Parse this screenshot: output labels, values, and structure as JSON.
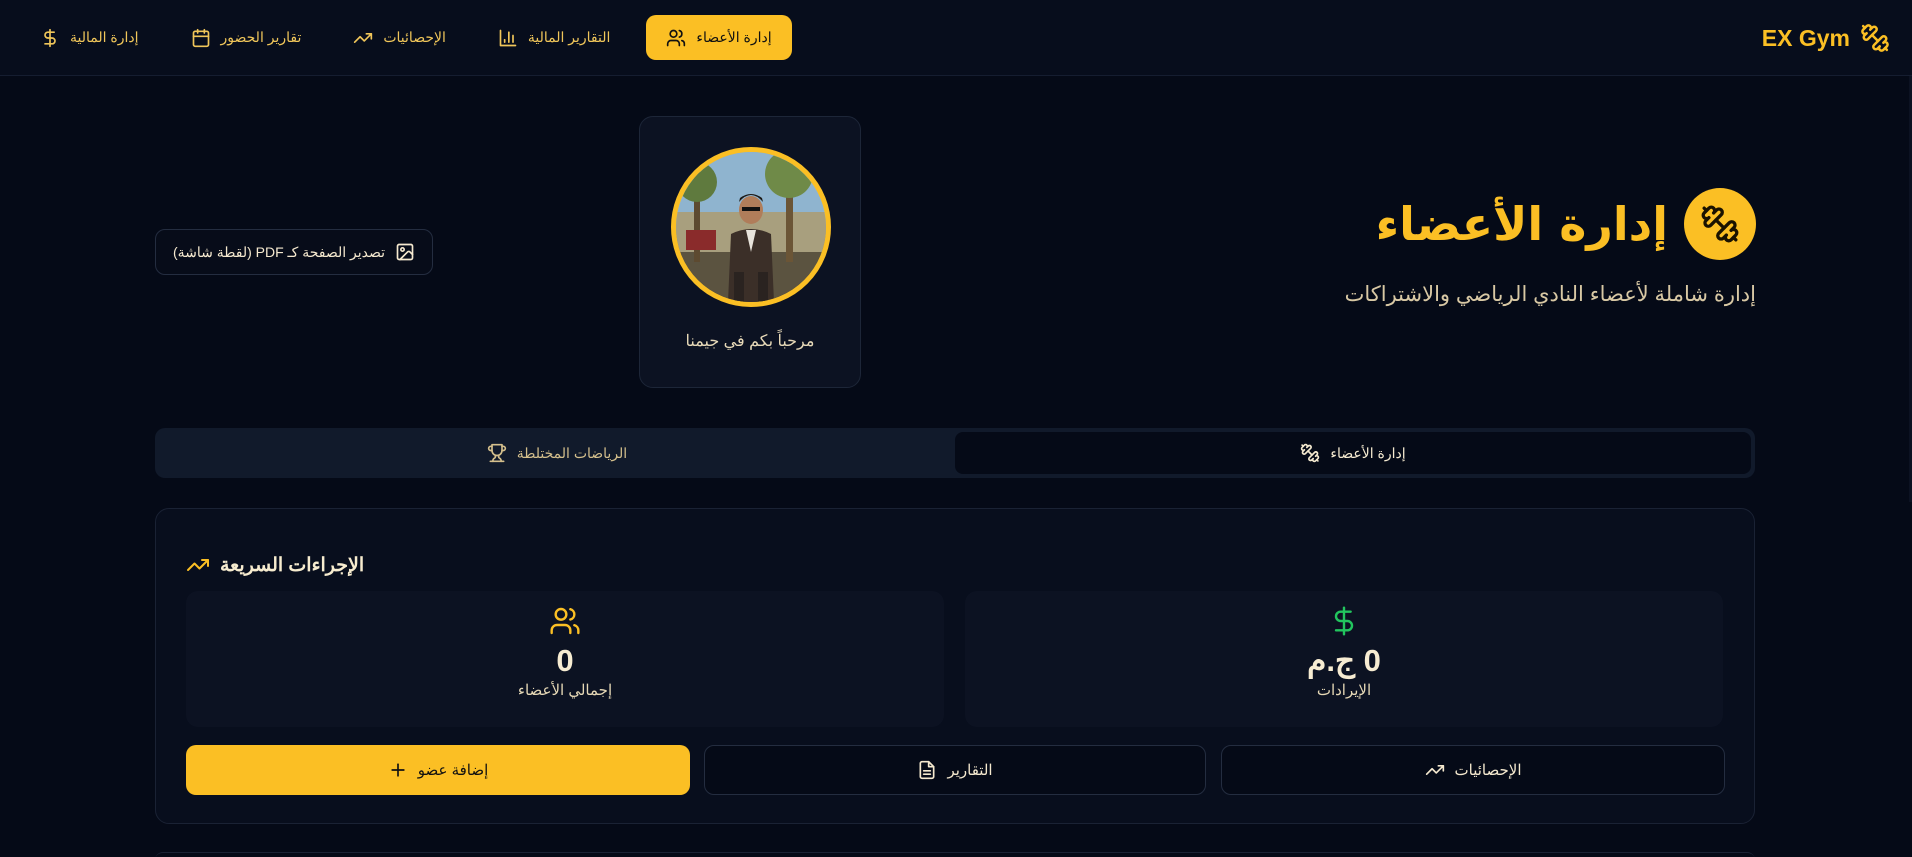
{
  "brand": {
    "name": "EX Gym",
    "icon": "dumbbell-icon"
  },
  "nav": {
    "items": [
      {
        "label": "إدارة الأعضاء",
        "icon": "users-icon",
        "active": true
      },
      {
        "label": "التقارير المالية",
        "icon": "bar-chart-icon",
        "active": false
      },
      {
        "label": "الإحصائيات",
        "icon": "trending-up-icon",
        "active": false
      },
      {
        "label": "تقارير الحضور",
        "icon": "calendar-icon",
        "active": false
      },
      {
        "label": "إدارة المالية",
        "icon": "dollar-icon",
        "active": false
      }
    ]
  },
  "hero": {
    "title": "إدارة الأعضاء",
    "subtitle": "إدارة شاملة لأعضاء النادي الرياضي والاشتراكات"
  },
  "profile": {
    "welcome": "مرحباً بكم في جيمنا"
  },
  "export": {
    "label": "تصدير الصفحة كـ PDF (لقطة شاشة)",
    "icon": "image-icon"
  },
  "tabs": [
    {
      "label": "إدارة الأعضاء",
      "icon": "dumbbell-icon",
      "active": true
    },
    {
      "label": "الرياضات المختلطة",
      "icon": "trophy-icon",
      "active": false
    }
  ],
  "quick_actions": {
    "title": "الإجراءات السريعة",
    "stats": {
      "members": {
        "value": "0",
        "label": "إجمالي الأعضاء",
        "icon": "users-icon"
      },
      "revenue": {
        "value": "0 ج.م",
        "label": "الإيرادات",
        "icon": "dollar-icon"
      }
    },
    "buttons": {
      "add_member": "إضافة عضو",
      "reports": "التقارير",
      "statistics": "الإحصائيات"
    }
  },
  "colors": {
    "accent": "#fbbf24",
    "background": "#050a17",
    "success": "#22c55e"
  }
}
